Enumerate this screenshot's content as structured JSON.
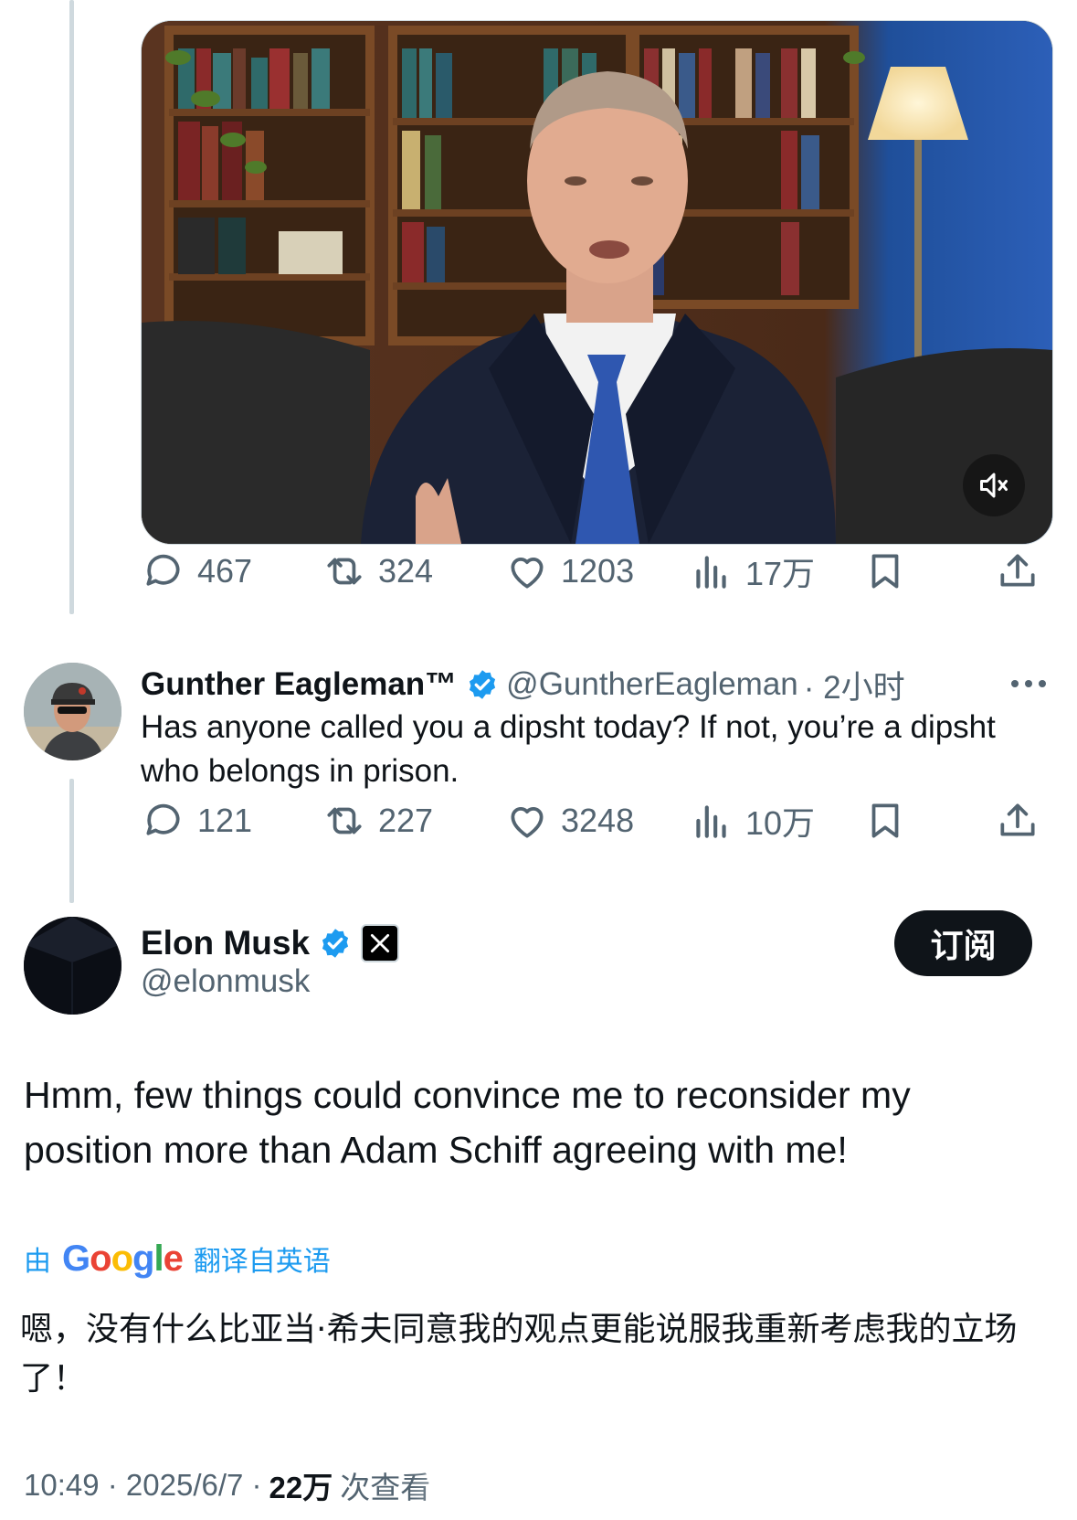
{
  "top_tweet": {
    "media_type": "video",
    "mute_icon": "speaker-muted-icon",
    "stats": {
      "replies": "467",
      "reposts": "324",
      "likes": "1203",
      "views": "17万"
    }
  },
  "reply_tweet": {
    "author_name": "Gunther Eagleman™",
    "author_handle": "@GuntherEagleman",
    "time": "· 2小时",
    "text": "Has anyone called you a dipsht today?  If not, you’re a dipsht who belongs in prison.",
    "stats": {
      "replies": "121",
      "reposts": "227",
      "likes": "3248",
      "views": "10万"
    }
  },
  "main_tweet": {
    "author_name": "Elon Musk",
    "author_handle": "@elonmusk",
    "subscribe_label": "订阅",
    "text": "Hmm, few things could convince me to reconsider my position more than Adam Schiff agreeing with me!",
    "translation": {
      "prefix": "由",
      "brand": "Google",
      "suffix": "翻译自英语",
      "text": "嗯，没有什么比亚当·希夫同意我的观点更能说服我重新考虑我的立场了！"
    },
    "meta": {
      "time": "10:49 · 2025/6/7 ·",
      "views": "22万",
      "views_suffix": "次查看"
    }
  },
  "colors": {
    "accent": "#1d9bf0",
    "text": "#0f1419",
    "secondary": "#536471",
    "line": "#cfd9de"
  }
}
